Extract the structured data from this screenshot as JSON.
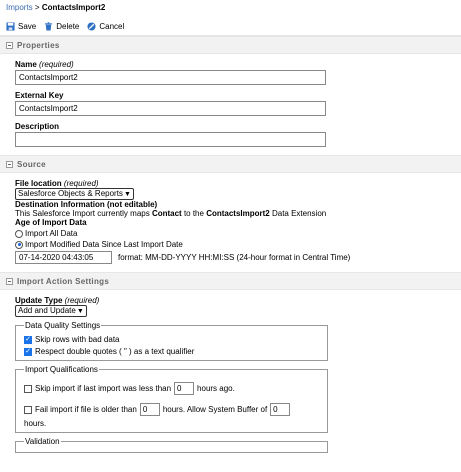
{
  "breadcrumb": {
    "parent": "Imports",
    "separator": ">",
    "current": "ContactsImport2"
  },
  "toolbar": {
    "save": "Save",
    "delete": "Delete",
    "cancel": "Cancel"
  },
  "properties": {
    "header": "Properties",
    "name_label": "Name",
    "name_required": "(required)",
    "name_value": "ContactsImport2",
    "external_key_label": "External Key",
    "external_key_value": "ContactsImport2",
    "description_label": "Description",
    "description_value": ""
  },
  "source": {
    "header": "Source",
    "file_location_label": "File location",
    "file_location_required": "(required)",
    "file_location_value": "Salesforce Objects & Reports",
    "dest_info_label": "Destination Information (not editable)",
    "dest_prefix": "This Salesforce Import currently maps ",
    "dest_object": "Contact",
    "dest_mid": " to the ",
    "dest_extension": "ContactsImport2",
    "dest_suffix": " Data Extension",
    "age_label": "Age of Import Data",
    "radio_all": "Import All Data",
    "radio_modified": "Import Modified Data Since Last Import Date",
    "date_value": "07-14-2020 04:43:05",
    "date_format": "format: MM-DD-YYYY HH:MI:SS (24-hour format in Central Time)"
  },
  "import_action": {
    "header": "Import Action Settings",
    "update_type_label": "Update Type",
    "update_type_required": "(required)",
    "update_type_value": "Add and Update",
    "dq_legend": "Data Quality Settings",
    "skip_bad": "Skip rows with bad data",
    "respect_quotes": "Respect double quotes ( \" ) as a text qualifier",
    "iq_legend": "Import Qualifications",
    "skip_last_prefix": "Skip import if last import was less than",
    "skip_last_value": "0",
    "skip_last_suffix": "hours ago.",
    "fail_old_prefix": "Fail import if file is older than",
    "fail_old_value": "0",
    "fail_old_mid": "hours. Allow System Buffer of",
    "buffer_value": "0",
    "fail_old_suffix": "hours.",
    "validation_legend": "Validation"
  },
  "colors": {
    "link": "#3c6db0",
    "checkbox": "#1a73e8",
    "section_bg": "#f2f2f2"
  }
}
